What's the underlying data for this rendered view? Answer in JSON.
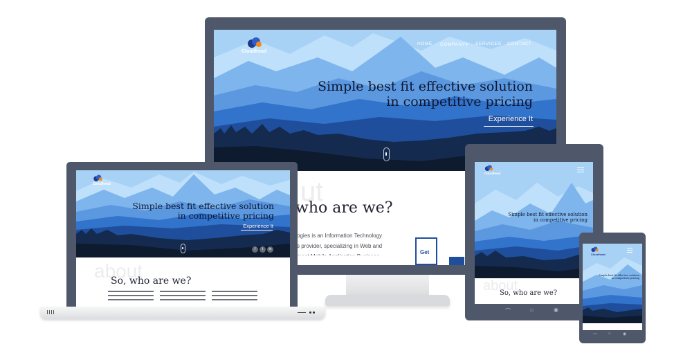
{
  "brand": {
    "name": "Cloudhead"
  },
  "nav": {
    "home": "HOME",
    "company": "COMPANY",
    "services": "SERVICES",
    "contact": "CONTACT"
  },
  "hero": {
    "line1": "Simple best fit effective solution",
    "line2": "in competitive pricing",
    "cta": "Experience It"
  },
  "about": {
    "ghost": "about",
    "ghost_tail": "ut",
    "title_full": "So, who are we?",
    "title_partial": "who are we?",
    "line1": "ogies is an Information Technology",
    "line2": "s provider, specializing in Web and",
    "line3": "ment Mobile Application Business",
    "get_button": "Get"
  },
  "social": [
    "f",
    "t",
    "in"
  ],
  "colors": {
    "frame": "#4f586a",
    "sky": "#a9d2f5",
    "mountain_dark": "#0e1a2e",
    "accent": "#1e63c7",
    "logo_orange": "#f28a1a"
  },
  "icons": {
    "back": "back-icon",
    "home": "home-icon",
    "recent": "recent-icon"
  }
}
